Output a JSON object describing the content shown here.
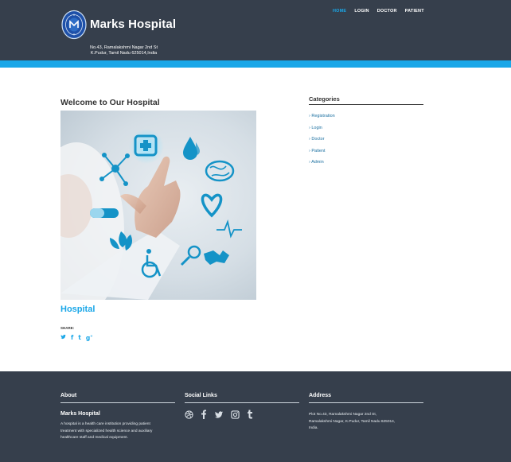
{
  "header": {
    "brand": "Marks Hospital",
    "address_line1": "No.43, Ramalakshmi Nagar 2nd St",
    "address_line2": "K.Pudur, Tamil Nadu 625014,India",
    "nav": [
      "HOME",
      "LOGIN",
      "DOCTOR",
      "PATIENT"
    ],
    "active_nav": "HOME"
  },
  "main": {
    "title": "Welcome to Our Hospital",
    "post_title": "Hospital",
    "share_label": "SHARE:",
    "share_icons": [
      "twitter-icon",
      "facebook-icon",
      "tumblr-icon",
      "google-plus-icon"
    ]
  },
  "sidebar": {
    "title": "Categories",
    "items": [
      "Registration",
      "Login",
      "Doctor",
      "Patient",
      "Admin"
    ]
  },
  "footer": {
    "about": {
      "heading": "About",
      "name": "Marks Hospital",
      "text_line1": "A hospital is a health care institution providing patient",
      "text_line2": "treatment with specialized health science and auxiliary",
      "text_line3": "healthcare staff and medical equipment."
    },
    "social": {
      "heading": "Social Links",
      "icons": [
        "dribbble-icon",
        "facebook-icon",
        "twitter-icon",
        "instagram-icon",
        "tumblr-icon"
      ]
    },
    "address": {
      "heading": "Address",
      "line1": "Plot No.43, Ramalakshmi Nagar 2nd St,",
      "line2": "Ramalakshmi Nagar, K.Pudur, Tamil Nadu 625014,",
      "line3": "India."
    }
  },
  "colors": {
    "header_bg": "#363f4c",
    "accent": "#1aa7e8",
    "footer_bg": "#363f4c"
  }
}
